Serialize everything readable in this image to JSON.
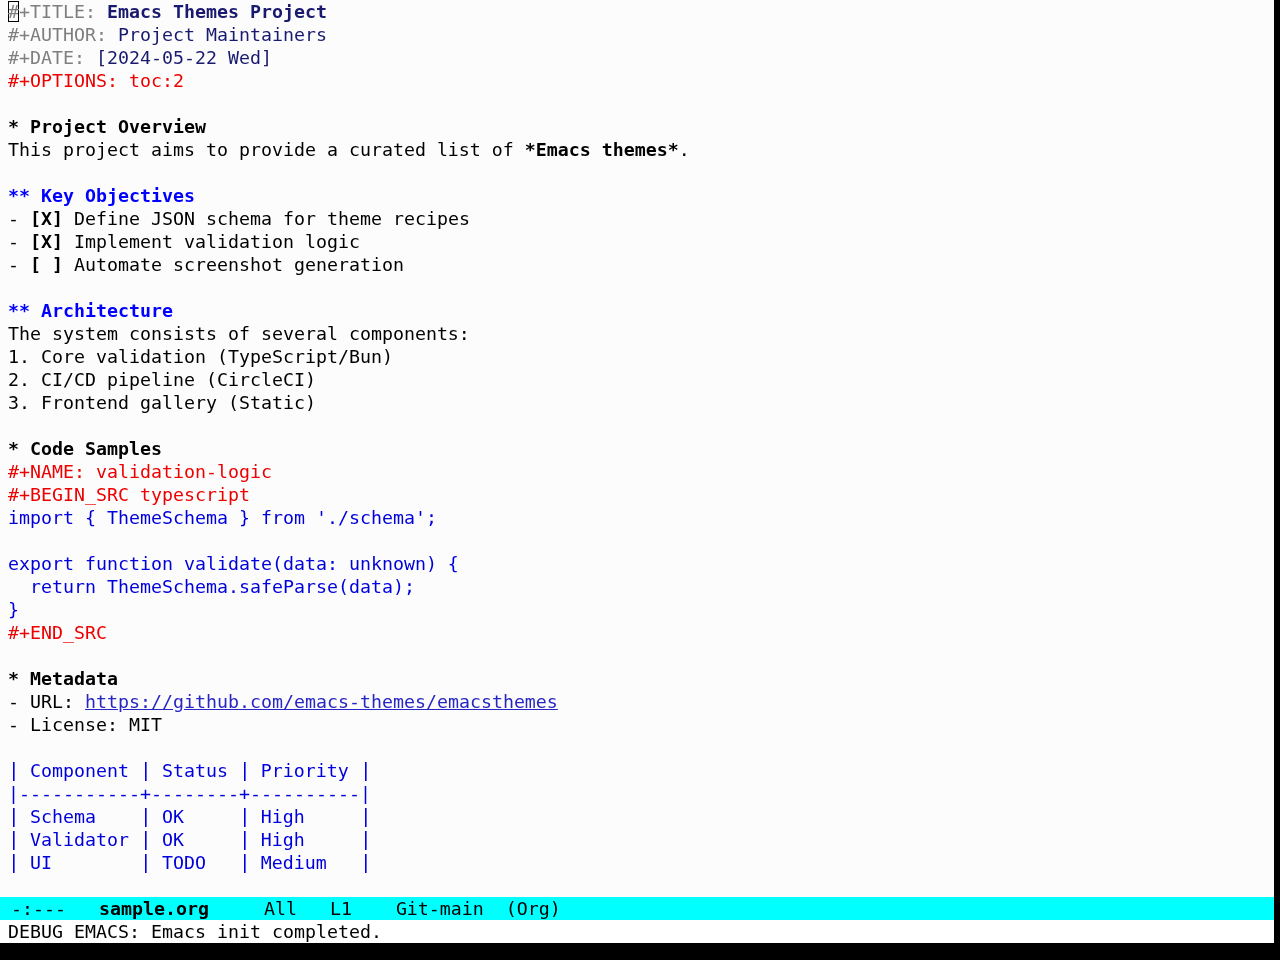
{
  "editor": {
    "keywords": [
      {
        "kind": "title",
        "key": "#+TITLE:",
        "value": "Emacs Themes Project",
        "cursor": true
      },
      {
        "kind": "info",
        "key": "#+AUTHOR:",
        "value": "Project Maintainers",
        "cursor": false
      },
      {
        "kind": "info",
        "key": "#+DATE:",
        "value": "[2024-05-22 Wed]",
        "cursor": false
      },
      {
        "kind": "option",
        "key": "#+OPTIONS:",
        "value": "toc:2",
        "cursor": false
      }
    ],
    "outline": [
      {
        "marker": "*",
        "title": "Project Overview",
        "body": [
          {
            "kind": "paragraph",
            "parts": [
              {
                "text": "This project aims to provide a curated list of ",
                "bold": false
              },
              {
                "text": "*Emacs themes*",
                "bold": true
              },
              {
                "text": ".",
                "bold": false
              }
            ]
          }
        ],
        "children": [
          {
            "marker": "**",
            "title": "Key Objectives",
            "body": [
              {
                "kind": "checkbox_item",
                "bullet": "-",
                "box": "[X]",
                "text": "Define JSON schema for theme recipes"
              },
              {
                "kind": "checkbox_item",
                "bullet": "-",
                "box": "[X]",
                "text": "Implement validation logic"
              },
              {
                "kind": "checkbox_item",
                "bullet": "-",
                "box": "[ ]",
                "text": "Automate screenshot generation"
              }
            ]
          },
          {
            "marker": "**",
            "title": "Architecture",
            "body": [
              {
                "kind": "paragraph",
                "parts": [
                  {
                    "text": "The system consists of several components:",
                    "bold": false
                  }
                ]
              },
              {
                "kind": "numbered_item",
                "bullet": "1.",
                "text": "Core validation (TypeScript/Bun)"
              },
              {
                "kind": "numbered_item",
                "bullet": "2.",
                "text": "CI/CD pipeline (CircleCI)"
              },
              {
                "kind": "numbered_item",
                "bullet": "3.",
                "text": "Frontend gallery (Static)"
              }
            ]
          }
        ]
      },
      {
        "marker": "*",
        "title": "Code Samples",
        "body": [
          {
            "kind": "src_block",
            "name_line": "#+NAME: validation-logic",
            "begin": "#+BEGIN_SRC typescript",
            "code": "import { ThemeSchema } from './schema';\n\nexport function validate(data: unknown) {\n  return ThemeSchema.safeParse(data);\n}",
            "end": "#+END_SRC"
          }
        ]
      },
      {
        "marker": "*",
        "title": "Metadata",
        "body": [
          {
            "kind": "link_item",
            "bullet": "-",
            "label": "URL:",
            "link": "https://github.com/emacs-themes/emacsthemes"
          },
          {
            "kind": "field_item",
            "bullet": "-",
            "label": "License:",
            "value": "MIT"
          },
          {
            "kind": "table",
            "columns": [
              "Component",
              "Status",
              "Priority"
            ],
            "rule": "|-----------+--------+----------|",
            "rows": [
              [
                "Schema",
                "OK",
                "High"
              ],
              [
                "Validator",
                "OK",
                "High"
              ],
              [
                "UI",
                "TODO",
                "Medium"
              ]
            ]
          }
        ]
      }
    ]
  },
  "mode_line": [
    {
      "text": "-:---",
      "bold": false
    },
    {
      "text": "sample.org",
      "bold": true
    },
    {
      "text": "All",
      "bold": false
    },
    {
      "text": "L1",
      "bold": false
    },
    {
      "text": "Git-main",
      "bold": false
    },
    {
      "text": "(Org)",
      "bold": false
    }
  ],
  "echo_area": "DEBUG EMACS: Emacs init completed."
}
